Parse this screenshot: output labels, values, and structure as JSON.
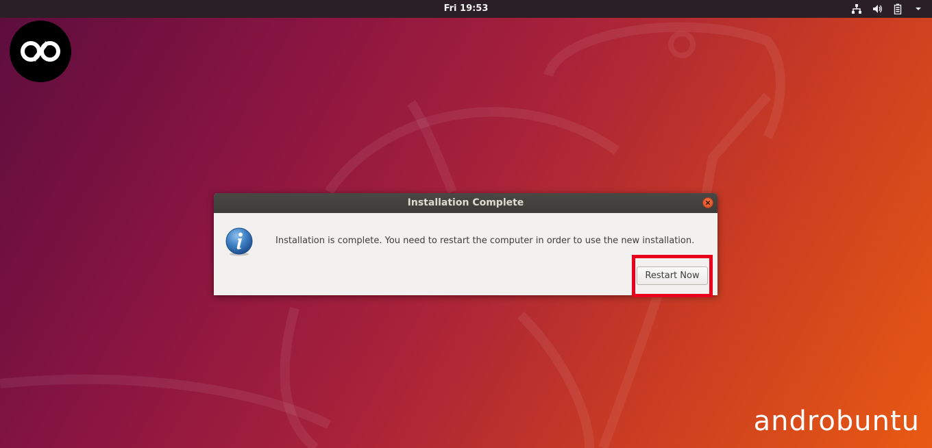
{
  "topbar": {
    "clock": "Fri 19:53",
    "tray_icons": [
      "network-icon",
      "volume-icon",
      "battery-icon",
      "system-menu-arrow-icon"
    ]
  },
  "dialog": {
    "title": "Installation Complete",
    "message": "Installation is complete. You need to restart the computer in order to use the new installation.",
    "restart_label": "Restart Now",
    "icon": "info-icon"
  },
  "watermark": {
    "brand_text": "androbuntu"
  },
  "colors": {
    "topbar_bg": "#2a1f24",
    "highlight": "#e8001d",
    "close_button": "#e0552a",
    "info_icon": "#2c6fb7"
  }
}
